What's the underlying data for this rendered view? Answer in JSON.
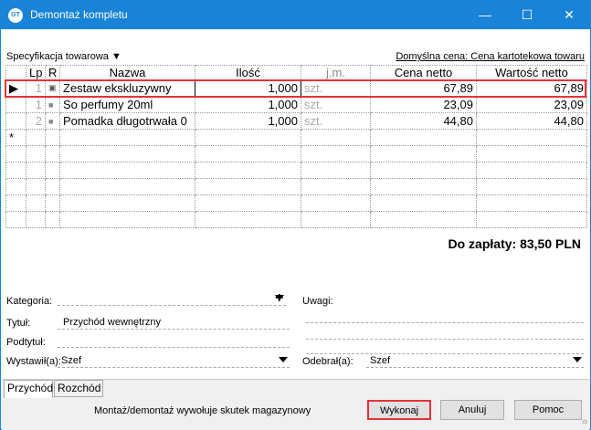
{
  "window": {
    "title": "Demontaż kompletu",
    "logo": "GT",
    "minimize_icon": "minimize-icon",
    "maximize_icon": "maximize-icon",
    "close_icon": "close-icon"
  },
  "spec_label": "Specyfikacja towarowa",
  "default_price": "Domyślna cena: Cena kartotekowa towaru",
  "table": {
    "headers": [
      "Lp",
      "R",
      "Nazwa",
      "Ilość",
      "j.m.",
      "Cena netto",
      "Wartość netto"
    ],
    "rows": [
      {
        "lp": "1",
        "name": "Zestaw ekskluzywny",
        "qty": "1,000",
        "unit": "szt.",
        "price": "67,89",
        "value": "67,89"
      },
      {
        "lp": "1",
        "name": "So perfumy 20ml",
        "qty": "1,000",
        "unit": "szt.",
        "price": "23,09",
        "value": "23,09"
      },
      {
        "lp": "2",
        "name": "Pomadka długotrwała 0",
        "qty": "1,000",
        "unit": "szt.",
        "price": "44,80",
        "value": "44,80"
      }
    ],
    "new_row_marker": "*"
  },
  "total": "Do zapłaty: 83,50 PLN",
  "form": {
    "kategoria_label": "Kategoria:",
    "kategoria_value": "",
    "tytul_label": "Tytuł:",
    "tytul_value": "Przychód wewnętrzny",
    "podtytul_label": "Podtytuł:",
    "podtytul_value": "",
    "wystawil_label": "Wystawił(a):",
    "wystawil_value": "Szef",
    "uwagi_label": "Uwagi:",
    "odebral_label": "Odebrał(a):",
    "odebral_value": "Szef"
  },
  "tabs": [
    "Przychód",
    "Rozchód"
  ],
  "note": "Montaż/demontaż wywołuje skutek magazynowy",
  "buttons": {
    "execute": "Wykonaj",
    "cancel": "Anuluj",
    "help": "Pomoc"
  },
  "colors": {
    "titlebar": "#1883d7",
    "highlight": "#e8313a"
  }
}
